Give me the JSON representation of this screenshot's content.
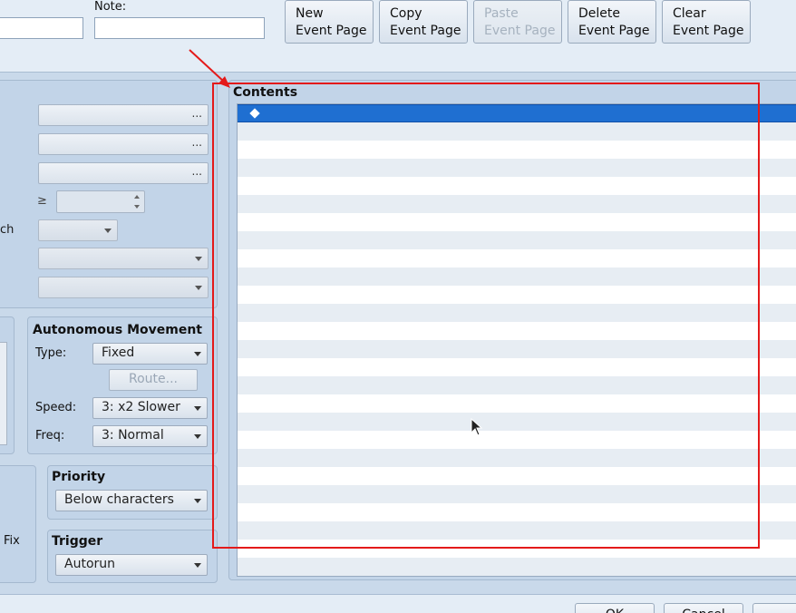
{
  "header": {
    "note_label": "Note:",
    "name_value": "",
    "note_value": "",
    "buttons": [
      {
        "line1": "New",
        "line2": "Event Page",
        "enabled": true
      },
      {
        "line1": "Copy",
        "line2": "Event Page",
        "enabled": true
      },
      {
        "line1": "Paste",
        "line2": "Event Page",
        "enabled": false
      },
      {
        "line1": "Delete",
        "line2": "Event Page",
        "enabled": true
      },
      {
        "line1": "Clear",
        "line2": "Event Page",
        "enabled": true
      }
    ]
  },
  "conditions": {
    "browse_glyph": "...",
    "ge_symbol": "≥",
    "switch_label_fragment": "ch"
  },
  "movement": {
    "title": "Autonomous Movement",
    "type_label": "Type:",
    "type_value": "Fixed",
    "route_label": "Route...",
    "speed_label": "Speed:",
    "speed_value": "3: x2 Slower",
    "freq_label": "Freq:",
    "freq_value": "3: Normal"
  },
  "options": {
    "fix_fragment": "Fix"
  },
  "priority": {
    "title": "Priority",
    "value": "Below characters"
  },
  "trigger": {
    "title": "Trigger",
    "value": "Autorun"
  },
  "contents": {
    "title": "Contents",
    "selected_row": 0,
    "row_count": 26
  },
  "footer": {
    "ok_label": "OK",
    "cancel_label": "Cancel"
  },
  "colors": {
    "annotation": "#e41a1a",
    "selection": "#1f6fd1",
    "panel": "#c2d4e8"
  }
}
